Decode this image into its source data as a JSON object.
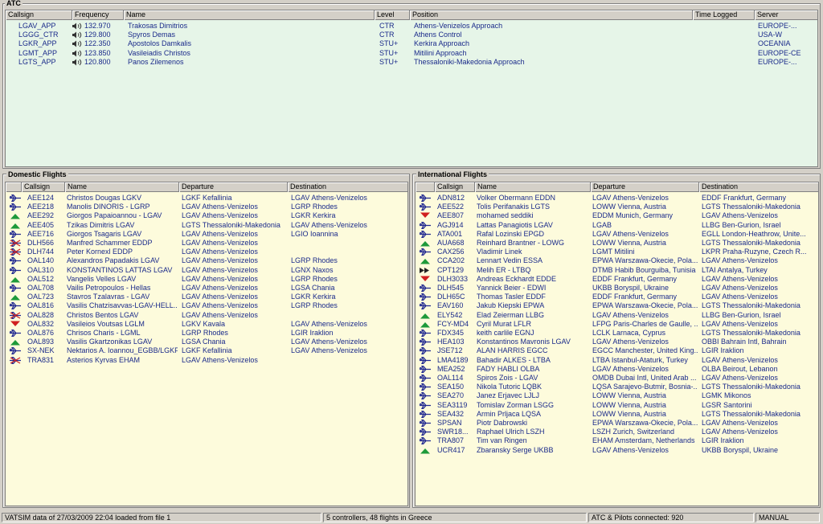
{
  "atc": {
    "title": "ATC",
    "columns": [
      "Callsign",
      "Frequency",
      "Name",
      "Level",
      "Position",
      "Time Logged",
      "Server"
    ],
    "rows": [
      {
        "callsign": "LGAV_APP",
        "frequency": "132.970",
        "name": "Trakosas Dimitrios",
        "level": "CTR",
        "position": "Athens-Venizelos Approach",
        "time": "",
        "server": "EUROPE-..."
      },
      {
        "callsign": "LGGG_CTR",
        "frequency": "129.800",
        "name": "Spyros Demas",
        "level": "CTR",
        "position": "Athens Control",
        "time": "",
        "server": "USA-W"
      },
      {
        "callsign": "LGKR_APP",
        "frequency": "122.350",
        "name": "Apostolos Damkalis",
        "level": "STU+",
        "position": "Kerkira Approach",
        "time": "",
        "server": "OCEANIA"
      },
      {
        "callsign": "LGMT_APP",
        "frequency": "123.850",
        "name": "Vasileiadis Christos",
        "level": "STU+",
        "position": "Mitilini Approach",
        "time": "",
        "server": "EUROPE-CE"
      },
      {
        "callsign": "LGTS_APP",
        "frequency": "120.800",
        "name": "Panos Zilemenos",
        "level": "STU+",
        "position": "Thessaloniki-Makedonia Approach",
        "time": "",
        "server": "EUROPE-..."
      }
    ]
  },
  "domestic": {
    "title": "Domestic Flights",
    "columns": [
      "Callsign",
      "Name",
      "Departure",
      "Destination"
    ],
    "rows": [
      {
        "icon": "plane",
        "callsign": "AEE124",
        "name": "Christos Dougas LGKV",
        "departure": "LGKF Kefallinia",
        "destination": "LGAV Athens-Venizelos"
      },
      {
        "icon": "plane",
        "callsign": "AEE218",
        "name": "Manolis DINORIS - LGRP",
        "departure": "LGAV Athens-Venizelos",
        "destination": "LGRP Rhodes"
      },
      {
        "icon": "climb",
        "callsign": "AEE292",
        "name": "Giorgos Papaioannou - LGAV",
        "departure": "LGAV Athens-Venizelos",
        "destination": "LGKR Kerkira"
      },
      {
        "icon": "climb",
        "callsign": "AEE405",
        "name": "Tzikas Dimitris LGAV",
        "departure": "LGTS Thessaloniki-Makedonia",
        "destination": "LGAV Athens-Venizelos"
      },
      {
        "icon": "plane",
        "callsign": "AEE716",
        "name": "Giorgos Tsagaris LGAV",
        "departure": "LGAV Athens-Venizelos",
        "destination": "LGIO Ioannina"
      },
      {
        "icon": "ground",
        "callsign": "DLH566",
        "name": "Manfred Schammer EDDP",
        "departure": "LGAV Athens-Venizelos",
        "destination": ""
      },
      {
        "icon": "ground",
        "callsign": "DLH744",
        "name": "Peter Kornexl EDDP",
        "departure": "LGAV Athens-Venizelos",
        "destination": ""
      },
      {
        "icon": "plane",
        "callsign": "OAL140",
        "name": "Alexandros Papadakis LGAV",
        "departure": "LGAV Athens-Venizelos",
        "destination": "LGRP Rhodes"
      },
      {
        "icon": "plane",
        "callsign": "OAL310",
        "name": "KONSTANTINOS LATTAS LGAV",
        "departure": "LGAV Athens-Venizelos",
        "destination": "LGNX Naxos"
      },
      {
        "icon": "climb",
        "callsign": "OAL512",
        "name": "Vangelis Velles LGAV",
        "departure": "LGAV Athens-Venizelos",
        "destination": "LGRP Rhodes"
      },
      {
        "icon": "plane",
        "callsign": "OAL708",
        "name": "Vailis Petropoulos - Hellas",
        "departure": "LGAV Athens-Venizelos",
        "destination": "LGSA Chania"
      },
      {
        "icon": "climb",
        "callsign": "OAL723",
        "name": "Stavros Tzalavras - LGAV",
        "departure": "LGAV Athens-Venizelos",
        "destination": "LGKR Kerkira"
      },
      {
        "icon": "plane",
        "callsign": "OAL816",
        "name": "Vasilis Chatzisavvas-LGAV-HELL...",
        "departure": "LGAV Athens-Venizelos",
        "destination": "LGRP Rhodes"
      },
      {
        "icon": "ground",
        "callsign": "OAL828",
        "name": "Christos Bentos LGAV",
        "departure": "LGAV Athens-Venizelos",
        "destination": ""
      },
      {
        "icon": "descend",
        "callsign": "OAL832",
        "name": "Vasileios Voutsas LGLM",
        "departure": "LGKV Kavala",
        "destination": "LGAV Athens-Venizelos"
      },
      {
        "icon": "plane",
        "callsign": "OAL876",
        "name": "Chrisos Charis - LGML",
        "departure": "LGRP Rhodes",
        "destination": "LGIR Iraklion"
      },
      {
        "icon": "climb",
        "callsign": "OAL893",
        "name": "Vasilis Gkartzonikas LGAV",
        "departure": "LGSA Chania",
        "destination": "LGAV Athens-Venizelos"
      },
      {
        "icon": "plane",
        "callsign": "SX-NEK",
        "name": "Nektarios A. Ioannou_EGBB/LGKF",
        "departure": "LGKF Kefallinia",
        "destination": "LGAV Athens-Venizelos"
      },
      {
        "icon": "ground",
        "callsign": "TRA831",
        "name": "Asterios Kyrvas EHAM",
        "departure": "LGAV Athens-Venizelos",
        "destination": ""
      }
    ]
  },
  "international": {
    "title": "International Flights",
    "columns": [
      "Callsign",
      "Name",
      "Departure",
      "Destination"
    ],
    "rows": [
      {
        "icon": "plane",
        "callsign": "ADN812",
        "name": "Volker Obermann EDDN",
        "departure": "LGAV Athens-Venizelos",
        "destination": "EDDF Frankfurt, Germany"
      },
      {
        "icon": "plane",
        "callsign": "AEE522",
        "name": "Tolis Perifanakis LGTS",
        "departure": "LOWW Vienna, Austria",
        "destination": "LGTS Thessaloniki-Makedonia"
      },
      {
        "icon": "descend",
        "callsign": "AEE807",
        "name": "mohamed seddiki",
        "departure": "EDDM Munich, Germany",
        "destination": "LGAV Athens-Venizelos"
      },
      {
        "icon": "plane",
        "callsign": "AGJ914",
        "name": "Lattas Panagiotis LGAV",
        "departure": "LGAB",
        "destination": "LLBG Ben-Gurion, Israel"
      },
      {
        "icon": "plane",
        "callsign": "ATA001",
        "name": "Rafal Lozinski EPGD",
        "departure": "LGAV Athens-Venizelos",
        "destination": "EGLL London-Heathrow, Unite..."
      },
      {
        "icon": "climb",
        "callsign": "AUA668",
        "name": "Reinhard Brantner - LOWG",
        "departure": "LOWW Vienna, Austria",
        "destination": "LGTS Thessaloniki-Makedonia"
      },
      {
        "icon": "plane",
        "callsign": "CAX256",
        "name": "Vladimir Linek",
        "departure": "LGMT Mitilini",
        "destination": "LKPR Praha-Ruzyne, Czech R..."
      },
      {
        "icon": "climb",
        "callsign": "CCA202",
        "name": "Lennart Vedin ESSA",
        "departure": "EPWA Warszawa-Okecie, Pola...",
        "destination": "LGAV Athens-Venizelos"
      },
      {
        "icon": "fast",
        "callsign": "CPT129",
        "name": "Melih ER - LTBQ",
        "departure": "DTMB Habib Bourguiba, Tunisia",
        "destination": "LTAI Antalya, Turkey"
      },
      {
        "icon": "descend",
        "callsign": "DLH3033",
        "name": "Andreas Eckhardt EDDE",
        "departure": "EDDF Frankfurt, Germany",
        "destination": "LGAV Athens-Venizelos"
      },
      {
        "icon": "plane",
        "callsign": "DLH545",
        "name": "Yannick Beier - EDWI",
        "departure": "UKBB Boryspil, Ukraine",
        "destination": "LGAV Athens-Venizelos"
      },
      {
        "icon": "plane",
        "callsign": "DLH65C",
        "name": "Thomas Tasler EDDF",
        "departure": "EDDF Frankfurt, Germany",
        "destination": "LGAV Athens-Venizelos"
      },
      {
        "icon": "plane",
        "callsign": "EAV160",
        "name": "Jakub Kiepski EPWA",
        "departure": "EPWA Warszawa-Okecie, Pola...",
        "destination": "LGTS Thessaloniki-Makedonia"
      },
      {
        "icon": "climb",
        "callsign": "ELY542",
        "name": "Elad Zeierman LLBG",
        "departure": "LGAV Athens-Venizelos",
        "destination": "LLBG Ben-Gurion, Israel"
      },
      {
        "icon": "climb",
        "callsign": "FCY-MD4",
        "name": "Cyril Murat LFLR",
        "departure": "LFPG Paris-Charles de Gaulle, ...",
        "destination": "LGAV Athens-Venizelos"
      },
      {
        "icon": "plane",
        "callsign": "FDX345",
        "name": "keith carlile EGNJ",
        "departure": "LCLK Larnaca, Cyprus",
        "destination": "LGTS Thessaloniki-Makedonia"
      },
      {
        "icon": "plane",
        "callsign": "HEA103",
        "name": "Konstantinos Mavronis LGAV",
        "departure": "LGAV Athens-Venizelos",
        "destination": "OBBI Bahrain Intl, Bahrain"
      },
      {
        "icon": "plane",
        "callsign": "JSE712",
        "name": "ALAN HARRIS EGCC",
        "departure": "EGCC Manchester, United King...",
        "destination": "LGIR Iraklion"
      },
      {
        "icon": "plane",
        "callsign": "LMA4189",
        "name": "Bahadir ALKES - LTBA",
        "departure": "LTBA Istanbul-Ataturk, Turkey",
        "destination": "LGAV Athens-Venizelos"
      },
      {
        "icon": "plane",
        "callsign": "MEA252",
        "name": "FADY HABLI OLBA",
        "departure": "LGAV Athens-Venizelos",
        "destination": "OLBA Beirout, Lebanon"
      },
      {
        "icon": "plane",
        "callsign": "OAL114",
        "name": "Spiros Zois - LGAV",
        "departure": "OMDB Dubai Intl, United Arab ...",
        "destination": "LGAV Athens-Venizelos"
      },
      {
        "icon": "plane",
        "callsign": "SEA150",
        "name": "Nikola Tutoric LQBK",
        "departure": "LQSA Sarajevo-Butmir, Bosnia-...",
        "destination": "LGTS Thessaloniki-Makedonia"
      },
      {
        "icon": "plane",
        "callsign": "SEA270",
        "name": "Janez Erjavec LJLJ",
        "departure": "LOWW Vienna, Austria",
        "destination": "LGMK Mikonos"
      },
      {
        "icon": "plane",
        "callsign": "SEA3119",
        "name": "Tomislav Zorman LSGG",
        "departure": "LOWW Vienna, Austria",
        "destination": "LGSR Santorini"
      },
      {
        "icon": "plane",
        "callsign": "SEA432",
        "name": "Armin Prljaca LQSA",
        "departure": "LOWW Vienna, Austria",
        "destination": "LGTS Thessaloniki-Makedonia"
      },
      {
        "icon": "plane",
        "callsign": "SPSAN",
        "name": "Piotr Dabrowski",
        "departure": "EPWA Warszawa-Okecie, Pola...",
        "destination": "LGAV Athens-Venizelos"
      },
      {
        "icon": "plane",
        "callsign": "SWR18...",
        "name": "Raphael Ulrich LSZH",
        "departure": "LSZH Zurich, Switzerland",
        "destination": "LGAV Athens-Venizelos"
      },
      {
        "icon": "plane",
        "callsign": "TRA807",
        "name": "Tim van Ringen",
        "departure": "EHAM Amsterdam, Netherlands",
        "destination": "LGIR Iraklion"
      },
      {
        "icon": "climb",
        "callsign": "UCR417",
        "name": "Zbaransky Serge UKBB",
        "departure": "LGAV Athens-Venizelos",
        "destination": "UKBB Boryspil, Ukraine"
      }
    ]
  },
  "status": {
    "data_info": "VATSIM data of 27/03/2009 22:04 loaded from file 1",
    "summary": "5 controllers, 48 flights in Greece",
    "connected": "ATC & Pilots connected: 920",
    "mode": "MANUAL"
  },
  "colors": {
    "atc_bg": "#e6f5e8",
    "flights_bg": "#fdfbdc",
    "text": "#1a2a8a",
    "plane_blue": "#202890",
    "climb_green": "#1e9a3a",
    "descend_red": "#d02020"
  },
  "icons": {
    "radio": "speaker-icon",
    "plane": "airplane-icon",
    "climb": "climbing-arrow-icon",
    "descend": "descending-arrow-icon",
    "ground": "grounded-airplane-icon",
    "fast": "fast-forward-icon"
  }
}
